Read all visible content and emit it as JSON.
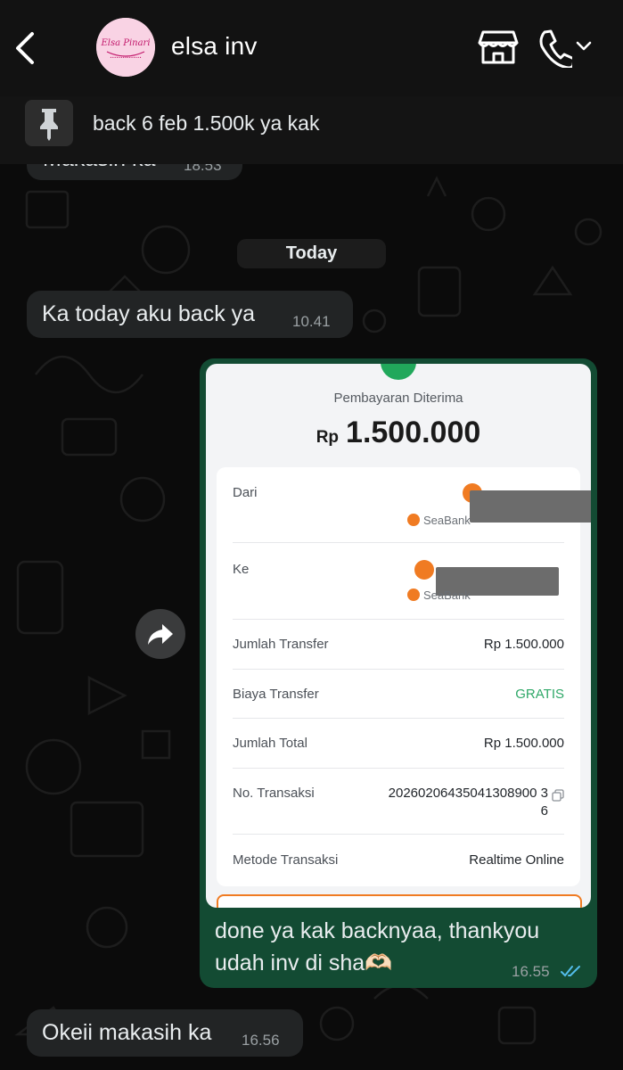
{
  "header": {
    "contact_name": "elsa inv",
    "avatar_logo_text": "Elsa Pinari",
    "icons": [
      "back-chevron-icon",
      "store-icon",
      "phone-icon",
      "chevron-down-icon"
    ]
  },
  "pinned": {
    "text": "back 6 feb 1.500k ya kak",
    "icon": "pin-icon"
  },
  "messages": {
    "prev": {
      "text": "Makasih ka",
      "time": "18.53"
    },
    "date_divider": "Today",
    "m1": {
      "text": "Ka today aku back ya",
      "time": "10.41"
    },
    "m2": {
      "line1": "done ya kak backnyaa, thankyou",
      "line2": "udah inv di sha🫶🏻",
      "time": "16.55",
      "status": "read-double-tick"
    },
    "m3": {
      "text": "Okeii makasih ka",
      "time": "16.56"
    }
  },
  "receipt": {
    "title": "Pembayaran Diterima",
    "amount_prefix": "Rp",
    "amount": "1.500.000",
    "rows": {
      "dari_label": "Dari",
      "dari_bank": "SeaBank",
      "ke_label": "Ke",
      "ke_bank": "SeaBank",
      "jumlah_transfer_label": "Jumlah Transfer",
      "jumlah_transfer_value": "Rp 1.500.000",
      "biaya_label": "Biaya Transfer",
      "biaya_value": "GRATIS",
      "total_label": "Jumlah Total",
      "total_value": "Rp 1.500.000",
      "no_label": "No. Transaksi",
      "no_value_1": "20260206435041308900 3",
      "no_value_2": "6",
      "metode_label": "Metode Transaksi",
      "metode_value": "Realtime Online"
    }
  },
  "colors": {
    "background": "#0b0b0b",
    "incoming_bubble": "#222425",
    "outgoing_bubble": "#134b33",
    "read_ticks": "#53bdeb",
    "gratis_green": "#2fa868",
    "accent_orange": "#f07b22"
  }
}
